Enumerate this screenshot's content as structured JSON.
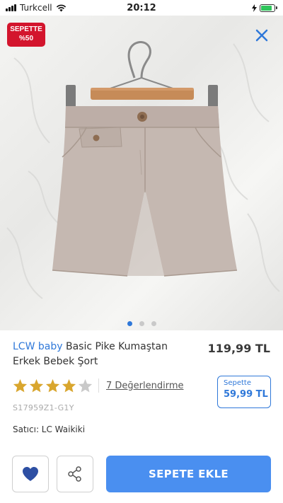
{
  "status_bar": {
    "carrier": "Turkcell",
    "time": "20:12",
    "icons": [
      "signal-icon",
      "wifi-icon",
      "battery-icon"
    ]
  },
  "hero": {
    "discount_badge": {
      "line1": "SEPETTE",
      "line2": "%50"
    },
    "close_icon": "close-icon",
    "carousel": {
      "total": 3,
      "active": 1
    }
  },
  "product": {
    "brand": "LCW baby",
    "name": "Basic Pike Kumaştan Erkek Bebek Şort",
    "price": "119,99 TL",
    "rating": {
      "value": 4,
      "max": 5,
      "reviews_label": "7 Değerlendirme"
    },
    "basket_offer": {
      "label": "Sepette",
      "price": "59,99 TL"
    },
    "sku": "S17959Z1-G1Y",
    "seller": "Satıcı: LC Waikiki"
  },
  "actions": {
    "favorite_icon": "heart-icon",
    "share_icon": "share-icon",
    "add_to_cart_label": "SEPETE EKLE"
  },
  "colors": {
    "accent": "#2f78d9",
    "button": "#4a8ff0",
    "badge": "#d3152d",
    "star": "#d9a62e"
  }
}
